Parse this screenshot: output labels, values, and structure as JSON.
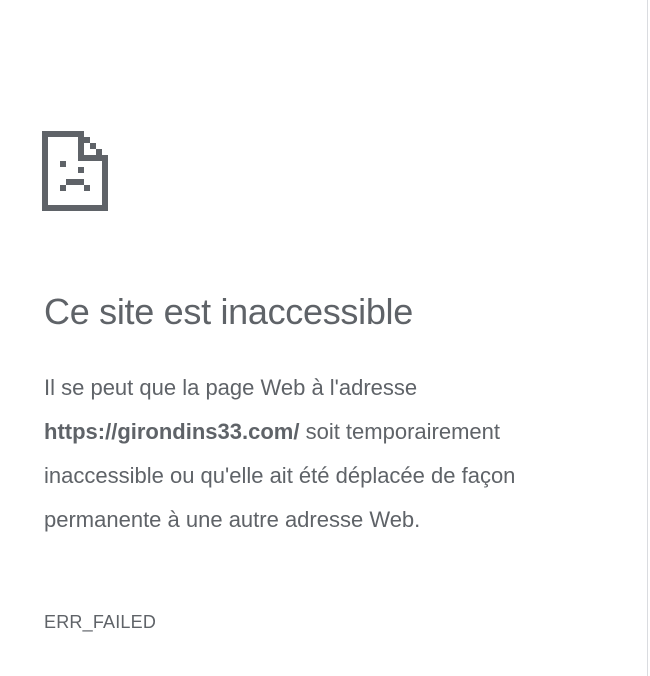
{
  "page": {
    "icon": "sad-page-icon",
    "title": "Ce site est inaccessible",
    "description": {
      "before_url": "Il se peut que la page Web à l'adresse",
      "url": "https://girondins33.com/",
      "after_url": " soit temporairement inaccessible ou qu'elle ait été déplacée de façon permanente à une autre adresse Web."
    },
    "error_code": "ERR_FAILED"
  },
  "colors": {
    "text": "#5f6368",
    "icon": "#5f6368",
    "background": "#ffffff",
    "border": "#dadce0"
  }
}
